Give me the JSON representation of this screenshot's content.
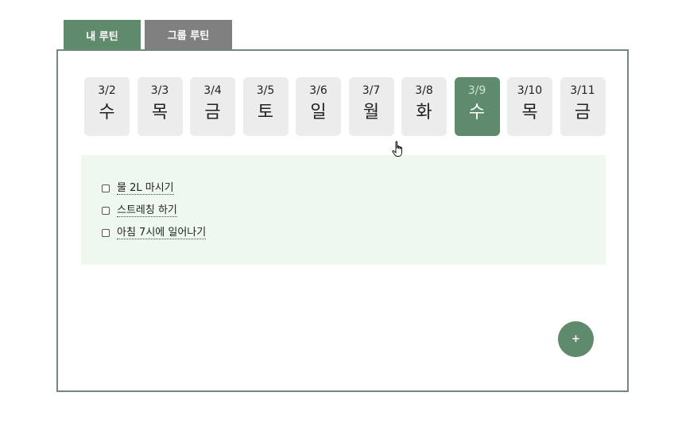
{
  "tabs": [
    {
      "label": "내 루틴",
      "active": true
    },
    {
      "label": "그룹 루틴",
      "active": false
    }
  ],
  "days": [
    {
      "date": "3/2",
      "weekday": "수",
      "selected": false
    },
    {
      "date": "3/3",
      "weekday": "목",
      "selected": false
    },
    {
      "date": "3/4",
      "weekday": "금",
      "selected": false
    },
    {
      "date": "3/5",
      "weekday": "토",
      "selected": false
    },
    {
      "date": "3/6",
      "weekday": "일",
      "selected": false
    },
    {
      "date": "3/7",
      "weekday": "월",
      "selected": false
    },
    {
      "date": "3/8",
      "weekday": "화",
      "selected": false
    },
    {
      "date": "3/9",
      "weekday": "수",
      "selected": true
    },
    {
      "date": "3/10",
      "weekday": "목",
      "selected": false
    },
    {
      "date": "3/11",
      "weekday": "금",
      "selected": false
    }
  ],
  "routines": [
    {
      "label": "물 2L 마시기",
      "checked": false
    },
    {
      "label": "스트레칭 하기",
      "checked": false
    },
    {
      "label": "아침 7시에 일어나기",
      "checked": false
    }
  ],
  "add_button": {
    "label": "+"
  },
  "colors": {
    "accent": "#5f8a6b",
    "inactive_tab": "#808080",
    "routine_bg": "#eef8ee",
    "day_bg": "#ececec"
  },
  "cursor": {
    "icon": "hand-pointer-icon"
  }
}
